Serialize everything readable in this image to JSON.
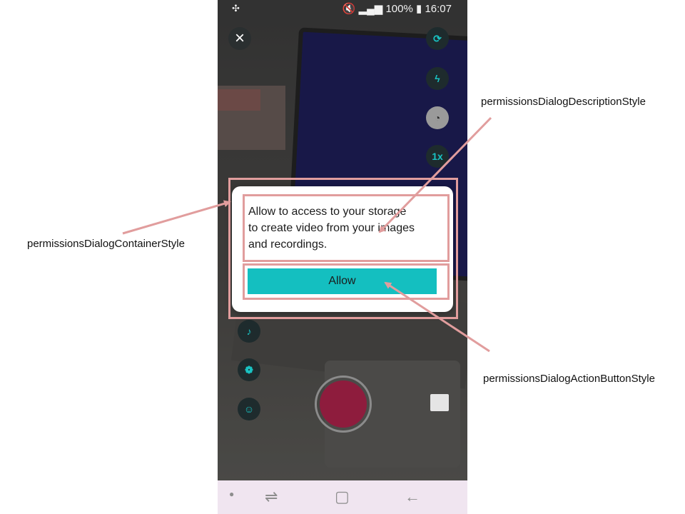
{
  "status_bar": {
    "battery": "100%",
    "time": "16:07"
  },
  "side_controls": {
    "zoom_label": "1x"
  },
  "dialog": {
    "description_lines": [
      "Allow to access to your storage",
      "to create video from your images",
      "and recordings."
    ],
    "action_label": "Allow"
  },
  "annotations": {
    "container": "permissionsDialogContainerStyle",
    "description": "permissionsDialogDescriptionStyle",
    "action_button": "permissionsDialogActionButtonStyle"
  },
  "colors": {
    "accent": "#14bfc0",
    "record": "#8e1c3d",
    "annotation": "#e19d9d"
  }
}
